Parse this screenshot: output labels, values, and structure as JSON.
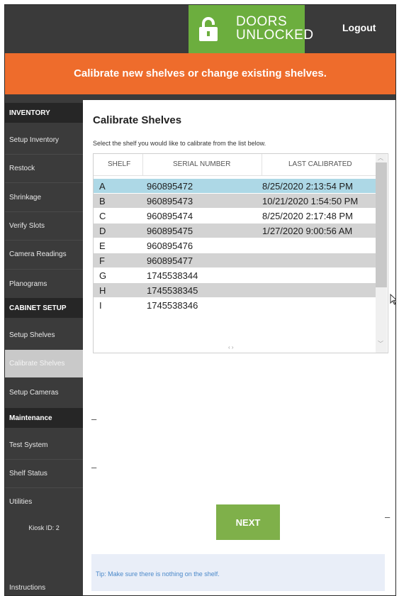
{
  "header": {
    "badge_line1": "DOORS",
    "badge_line2": "UNLOCKED",
    "logout_label": "Logout",
    "banner_text": "Calibrate new shelves or change existing shelves.",
    "colors": {
      "topbar": "#3a3a3a",
      "badge": "#6cae3e",
      "banner": "#ee6c2c"
    }
  },
  "sidebar": {
    "items": [
      {
        "label": "INVENTORY",
        "type": "header"
      },
      {
        "label": "Setup Inventory",
        "type": "item"
      },
      {
        "label": "Restock",
        "type": "item"
      },
      {
        "label": "Shrinkage",
        "type": "item"
      },
      {
        "label": "Verify Slots",
        "type": "item"
      },
      {
        "label": "Camera Readings",
        "type": "item"
      },
      {
        "label": "Planograms",
        "type": "item"
      },
      {
        "label": "CABINET SETUP",
        "type": "header"
      },
      {
        "label": "Setup Shelves",
        "type": "item"
      },
      {
        "label": "Calibrate Shelves",
        "type": "item",
        "active": true
      },
      {
        "label": "Setup Cameras",
        "type": "item"
      },
      {
        "label": "Maintenance",
        "type": "header"
      },
      {
        "label": "Test System",
        "type": "item"
      },
      {
        "label": "Shelf Status",
        "type": "item"
      },
      {
        "label": "Utilities",
        "type": "item"
      }
    ],
    "kiosk_id": "Kiosk ID: 2",
    "instructions_label": "Instructions"
  },
  "main": {
    "title": "Calibrate Shelves",
    "subtitle": "Select the shelf you would like to calibrate from the list below.",
    "table": {
      "columns": [
        "SHELF",
        "SERIAL NUMBER",
        "LAST CALIBRATED"
      ],
      "rows": [
        {
          "shelf": "A",
          "serial": "960895472",
          "last": "8/25/2020 2:13:54 PM",
          "selected": true
        },
        {
          "shelf": "B",
          "serial": "960895473",
          "last": "10/21/2020 1:54:50 PM"
        },
        {
          "shelf": "C",
          "serial": "960895474",
          "last": "8/25/2020 2:17:48 PM"
        },
        {
          "shelf": "D",
          "serial": "960895475",
          "last": "1/27/2020 9:00:56 AM"
        },
        {
          "shelf": "E",
          "serial": "960895476",
          "last": ""
        },
        {
          "shelf": "F",
          "serial": "960895477",
          "last": ""
        },
        {
          "shelf": "G",
          "serial": "1745538344",
          "last": ""
        },
        {
          "shelf": "H",
          "serial": "1745538345",
          "last": ""
        },
        {
          "shelf": "I",
          "serial": "1745538346",
          "last": ""
        }
      ],
      "colors": {
        "selected_row": "#add8e6",
        "alt_row": "#d3d3d3",
        "row": "#ffffff"
      }
    },
    "dash1": "–",
    "dash2": "–",
    "dash3": "–",
    "next_label": "NEXT",
    "tip": "Tip: Make sure there is nothing on the shelf."
  }
}
